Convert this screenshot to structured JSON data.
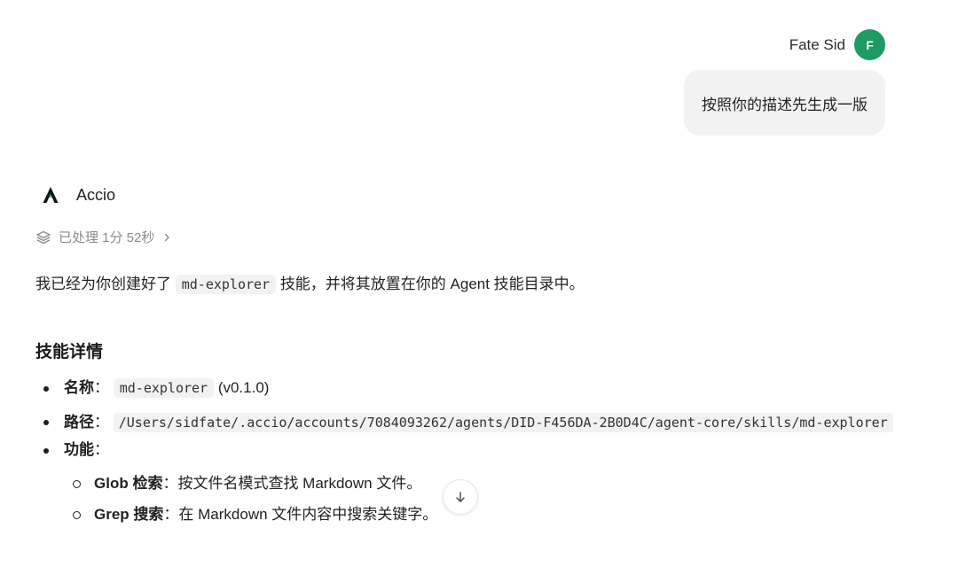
{
  "user": {
    "name": "Fate Sid",
    "avatar_initial": "F",
    "avatar_color": "#1e9a63",
    "message": "按照你的描述先生成一版"
  },
  "agent": {
    "name": "Accio",
    "processed_label": "已处理 1分 52秒",
    "intro_before": "我已经为你创建好了",
    "intro_code": "md-explorer",
    "intro_after": "技能，并将其放置在你的 Agent 技能目录中。",
    "section_title": "技能详情",
    "details": {
      "name_label": "名称",
      "name_sep": "：",
      "name_code": "md-explorer",
      "name_version": "(v0.1.0)",
      "path_label": "路径",
      "path_sep": "：",
      "path_code": "/Users/sidfate/.accio/accounts/7084093262/agents/DID-F456DA-2B0D4C/agent-core/skills/md-explorer",
      "func_label": "功能",
      "func_sep": "：",
      "features": [
        {
          "label": "Glob 检索",
          "sep": "：",
          "text": "按文件名模式查找 Markdown 文件。"
        },
        {
          "label": "Grep 搜索",
          "sep": "：",
          "text": "在 Markdown 文件内容中搜索关键字。"
        }
      ]
    }
  },
  "icons": {
    "processed": "layers-icon",
    "chevron": "chevron-right-icon",
    "scroll": "arrow-down-icon",
    "logo": "accio-logo-icon"
  }
}
